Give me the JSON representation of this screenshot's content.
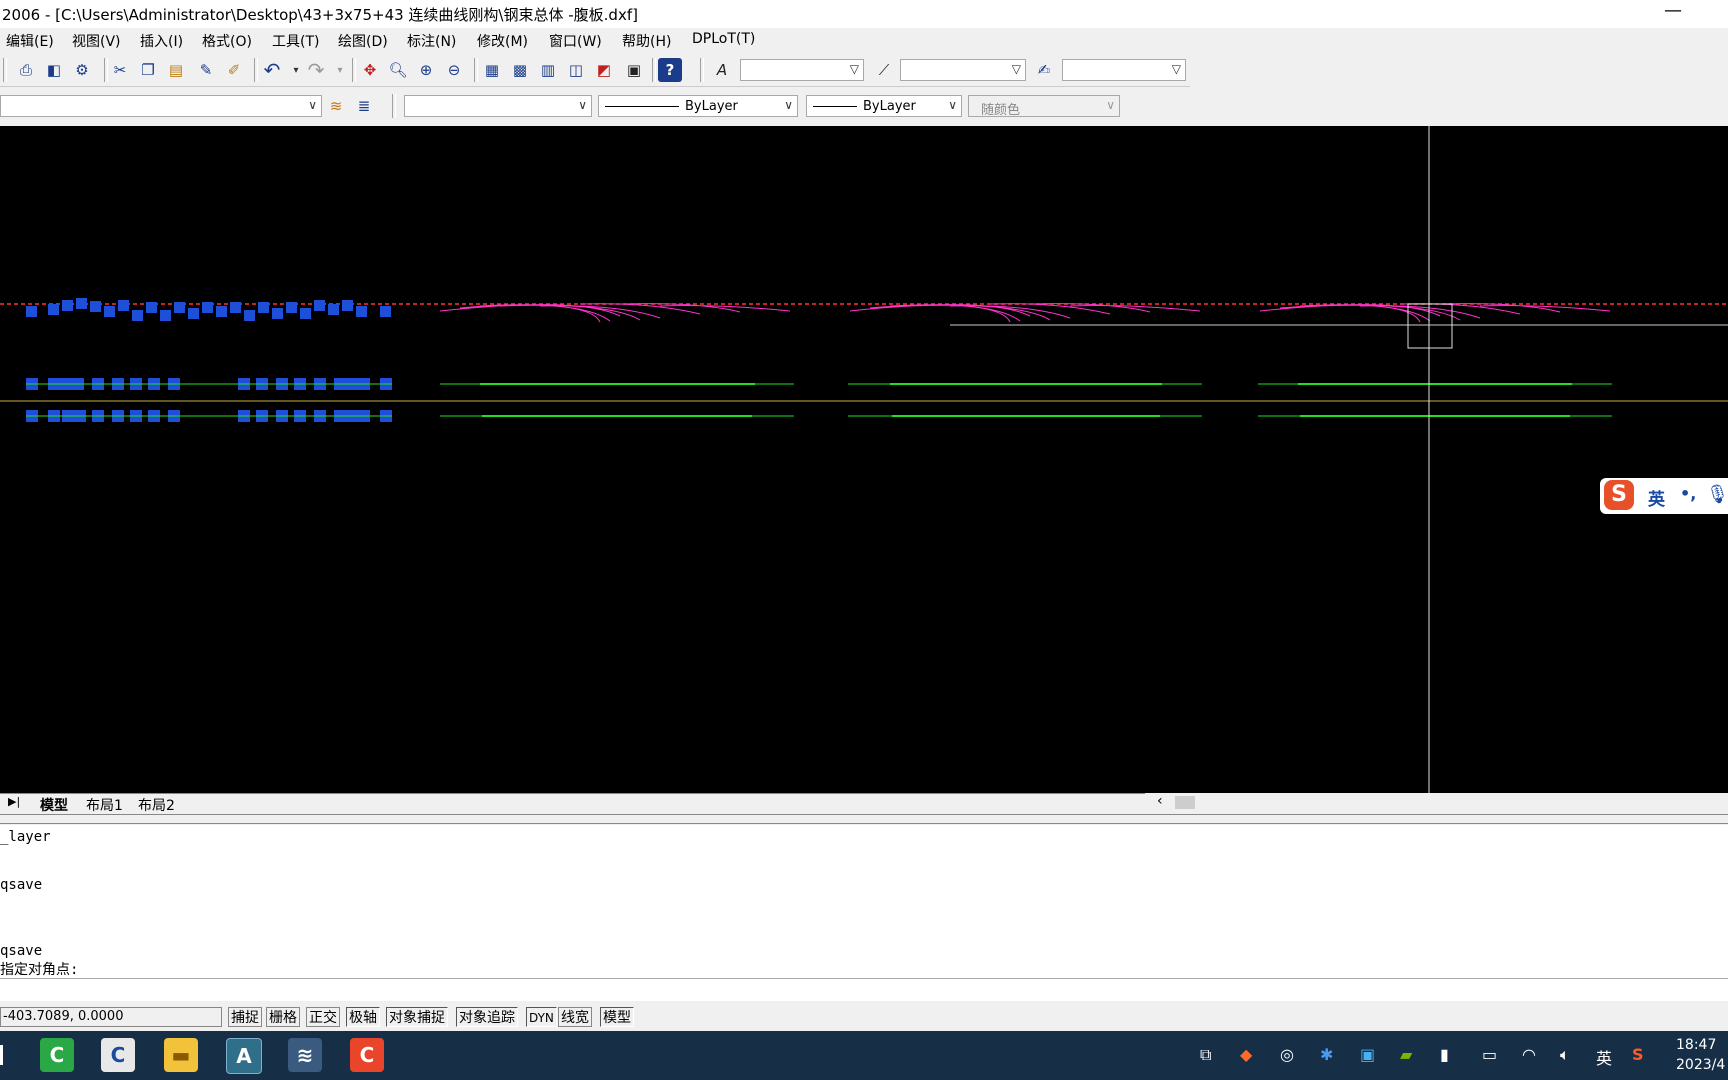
{
  "window": {
    "title": "2006 - [C:\\Users\\Administrator\\Desktop\\43+3x75+43 连续曲线刚构\\钢束总体 -腹板.dxf]",
    "minimize": "—"
  },
  "menu": [
    "编辑(E)",
    "视图(V)",
    "插入(I)",
    "格式(O)",
    "工具(T)",
    "绘图(D)",
    "标注(N)",
    "修改(M)",
    "窗口(W)",
    "帮助(H)",
    "DPLoT(T)"
  ],
  "properties": {
    "linetype": "ByLayer",
    "lineweight": "ByLayer",
    "plotstyle": "随颜色"
  },
  "layout_tabs": [
    "模型",
    "布局1",
    "布局2"
  ],
  "command_history": [
    "_layer",
    "qsave",
    "qsave",
    "指定对角点:"
  ],
  "status": {
    "coordinates": "-403.7089, 0.0000",
    "toggles": [
      "捕捉",
      "栅格",
      "正交",
      "极轴",
      "对象捕捉",
      "对象追踪",
      "DYN",
      "线宽",
      "模型"
    ]
  },
  "ime": {
    "label": "英",
    "punct": "•,"
  },
  "tray": {
    "lang": "英",
    "time": "18:47",
    "date": "2023/4"
  },
  "colors": {
    "canvas": "#000000",
    "grip": "#1e4fd8",
    "tendon": "#ff33cc",
    "slab_line": "#22dd22",
    "axis": "#ff3333",
    "taskbar": "#162f47"
  }
}
